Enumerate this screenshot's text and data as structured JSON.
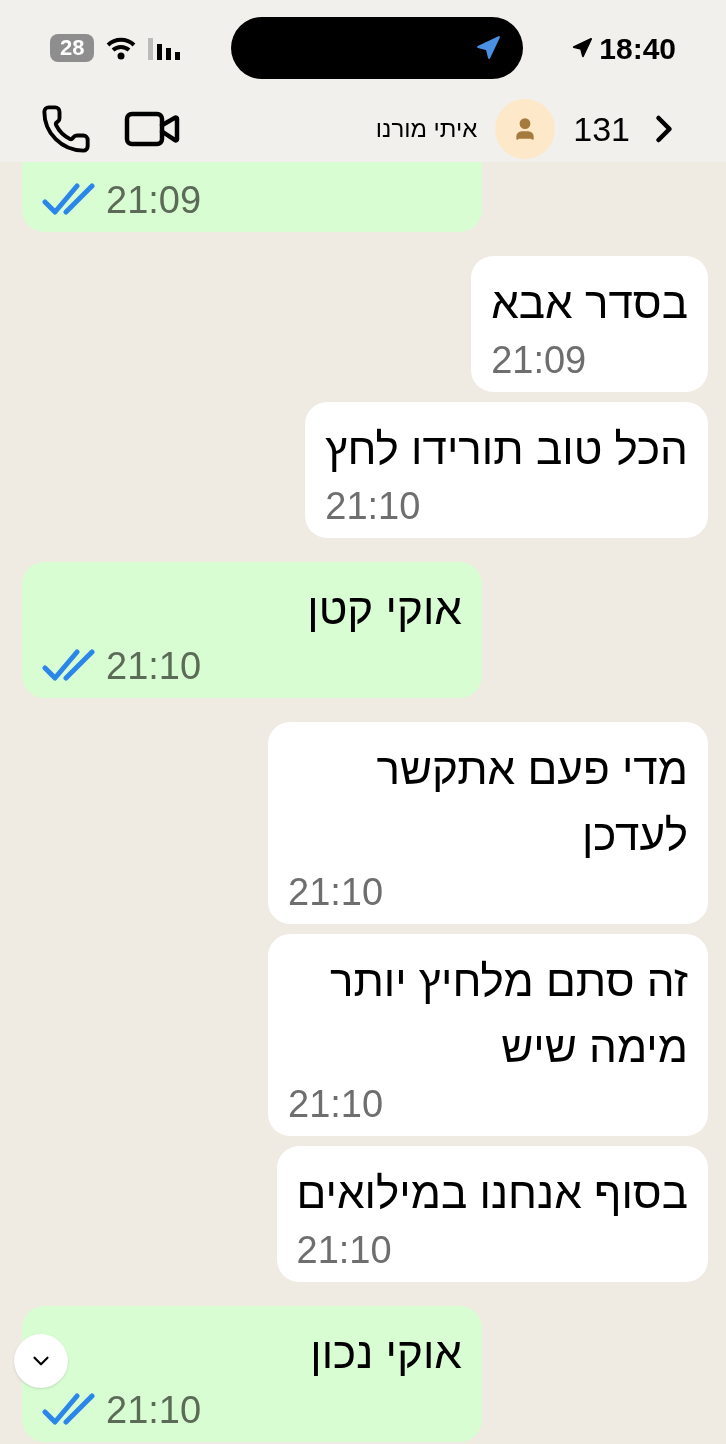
{
  "status_bar": {
    "battery": "28",
    "time": "18:40"
  },
  "header": {
    "back_count": "131",
    "contact_name": "איתי מורנו"
  },
  "messages": [
    {
      "kind": "sent",
      "time": "21:09",
      "read": true
    },
    {
      "kind": "received",
      "text": "בסדר אבא",
      "time": "21:09"
    },
    {
      "kind": "received",
      "text": "הכל טוב תורידו לחץ",
      "time": "21:10"
    },
    {
      "kind": "sent",
      "text": "אוקי קטן",
      "time": "21:10",
      "read": true
    },
    {
      "kind": "received",
      "text": "מדי פעם אתקשר לעדכן",
      "time": "21:10"
    },
    {
      "kind": "received",
      "text": "זה סתם מלחיץ יותר מימה שיש",
      "time": "21:10"
    },
    {
      "kind": "received",
      "text": "בסוף אנחנו במילואים",
      "time": "21:10"
    },
    {
      "kind": "sent",
      "text": "אוקי נכון",
      "time": "21:10",
      "read": true
    }
  ]
}
